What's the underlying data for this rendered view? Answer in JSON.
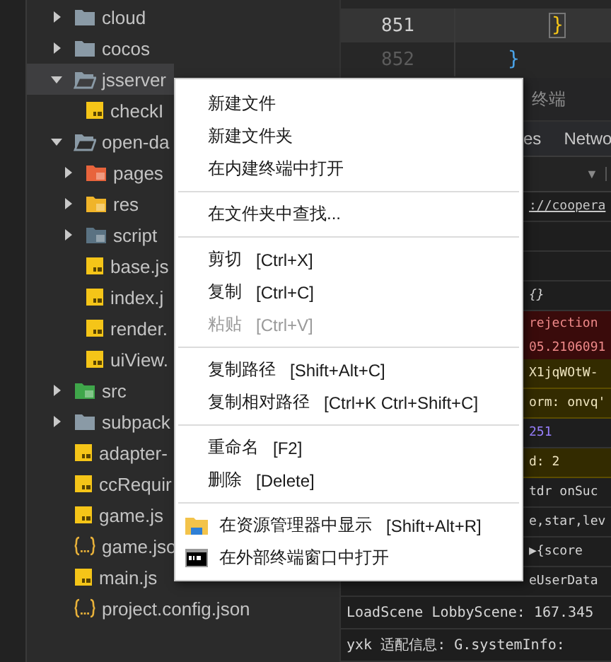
{
  "file_tree": [
    {
      "label": "cloud",
      "kind": "folder",
      "expanded": false,
      "selected": false
    },
    {
      "label": "cocos",
      "kind": "folder",
      "expanded": false,
      "selected": false
    },
    {
      "label": "jsserver",
      "kind": "folder",
      "expanded": true,
      "selected": true,
      "children": [
        {
          "label": "checkI",
          "kind": "js",
          "selected": false
        }
      ]
    },
    {
      "label": "open-da",
      "kind": "folder",
      "expanded": true,
      "selected": false,
      "children": [
        {
          "label": "pages",
          "kind": "pages-folder",
          "expanded": false,
          "selected": false
        },
        {
          "label": "res",
          "kind": "res-folder",
          "expanded": false,
          "selected": false
        },
        {
          "label": "script",
          "kind": "script-folder",
          "expanded": false,
          "selected": false
        },
        {
          "label": "base.js",
          "kind": "js",
          "selected": false
        },
        {
          "label": "index.j",
          "kind": "js",
          "selected": false
        },
        {
          "label": "render.",
          "kind": "js",
          "selected": false
        },
        {
          "label": "uiView.",
          "kind": "js",
          "selected": false
        }
      ]
    },
    {
      "label": "src",
      "kind": "src-folder",
      "expanded": false,
      "selected": false
    },
    {
      "label": "subpack",
      "kind": "folder",
      "expanded": false,
      "selected": false
    },
    {
      "label": "adapter-",
      "kind": "js",
      "selected": false
    },
    {
      "label": "ccRequir",
      "kind": "js",
      "selected": false
    },
    {
      "label": "game.js",
      "kind": "js",
      "selected": false
    },
    {
      "label": "game.jso",
      "kind": "json",
      "selected": false
    },
    {
      "label": "main.js",
      "kind": "js",
      "selected": false
    },
    {
      "label": "project.config.json",
      "kind": "json",
      "selected": false
    }
  ],
  "editor": {
    "lines": [
      {
        "number": "851",
        "current": true,
        "code": "}"
      },
      {
        "number": "852",
        "current": false,
        "code": "}"
      }
    ]
  },
  "panel": {
    "tab": "终端",
    "devtools_tabs": [
      "es",
      "Netwo"
    ],
    "filter_dropdown": "▼"
  },
  "console_strip": [
    {
      "kind": "link",
      "text": "://coopera"
    },
    {
      "kind": "blank"
    },
    {
      "kind": "blank"
    },
    {
      "kind": "object",
      "text": "{}"
    },
    {
      "kind": "error",
      "text": "rejection"
    },
    {
      "kind": "error",
      "text": "05.2106091"
    },
    {
      "kind": "warning",
      "text": "X1jqWOtW-"
    },
    {
      "kind": "warning",
      "text": "orm: onvq'"
    },
    {
      "kind": "number",
      "text": "251"
    },
    {
      "kind": "warning",
      "text": "d:  2"
    },
    {
      "kind": "log",
      "text": "tdr onSuc"
    },
    {
      "kind": "log",
      "text": "e,star,lev"
    },
    {
      "kind": "log",
      "text": "▶{score"
    },
    {
      "kind": "log",
      "text": "eUserData"
    }
  ],
  "console_rows": [
    "LoadScene LobbyScene: 167.345",
    "yxk 适配信息: G.systemInfo:"
  ],
  "context_menu": [
    {
      "kind": "item",
      "label": "新建文件",
      "disabled": false
    },
    {
      "kind": "item",
      "label": "新建文件夹",
      "disabled": false
    },
    {
      "kind": "item",
      "label": "在内建终端中打开",
      "disabled": false
    },
    {
      "kind": "separator"
    },
    {
      "kind": "item",
      "label": "在文件夹中查找...",
      "disabled": false
    },
    {
      "kind": "separator"
    },
    {
      "kind": "item",
      "label": "剪切",
      "shortcut": "[Ctrl+X]",
      "disabled": false
    },
    {
      "kind": "item",
      "label": "复制",
      "shortcut": "[Ctrl+C]",
      "disabled": false
    },
    {
      "kind": "item",
      "label": "粘贴",
      "shortcut": "[Ctrl+V]",
      "disabled": true
    },
    {
      "kind": "separator"
    },
    {
      "kind": "item",
      "label": "复制路径",
      "shortcut": "[Shift+Alt+C]",
      "disabled": false
    },
    {
      "kind": "item",
      "label": "复制相对路径",
      "shortcut": "[Ctrl+K Ctrl+Shift+C]",
      "disabled": false
    },
    {
      "kind": "separator"
    },
    {
      "kind": "item",
      "label": "重命名",
      "shortcut": "[F2]",
      "disabled": false
    },
    {
      "kind": "item",
      "label": "删除",
      "shortcut": "[Delete]",
      "disabled": false
    },
    {
      "kind": "separator"
    },
    {
      "kind": "item",
      "label": "在资源管理器中显示",
      "shortcut": "[Shift+Alt+R]",
      "disabled": false
    },
    {
      "kind": "item",
      "label": "在外部终端窗口中打开",
      "disabled": false
    }
  ]
}
